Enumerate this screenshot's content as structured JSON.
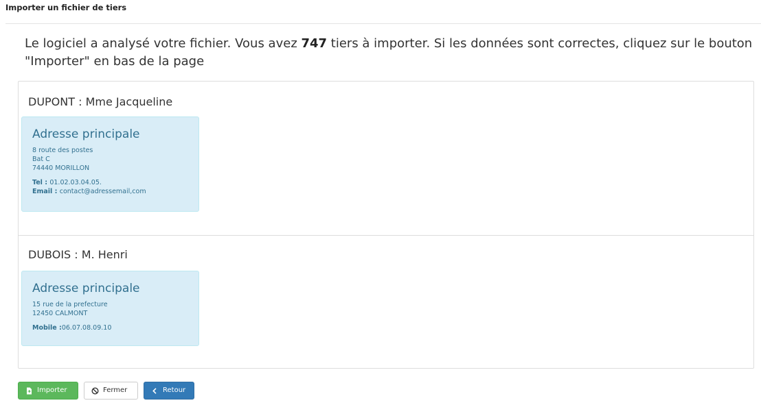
{
  "header": {
    "title": "Importer un fichier de tiers"
  },
  "intro": {
    "text_before": "Le logiciel a analysé votre fichier. Vous avez ",
    "count": "747",
    "text_after": " tiers à importer. Si les données sont correctes, cliquez sur le bouton \"Importer\" en bas de la page"
  },
  "tiers": [
    {
      "name": "DUPONT : Mme Jacqueline",
      "address": {
        "title": "Adresse principale",
        "lines": [
          "8 route des postes",
          "Bat C",
          "74440 MORILLON"
        ],
        "contacts": [
          {
            "label": "Tel : ",
            "value": "01.02.03.04.05."
          },
          {
            "label": "Email : ",
            "value": "contact@adressemail,com"
          }
        ]
      }
    },
    {
      "name": "DUBOIS : M. Henri",
      "address": {
        "title": "Adresse principale",
        "lines": [
          "15 rue de la prefecture",
          "12450 CALMONT"
        ],
        "contacts": [
          {
            "label": "Mobile :",
            "value": "06.07.08.09.10"
          }
        ]
      }
    }
  ],
  "buttons": {
    "import": {
      "label": "Importer",
      "icon": "file-import-icon"
    },
    "close": {
      "label": "Fermer",
      "icon": "ban-icon"
    },
    "back": {
      "label": "Retour",
      "icon": "chevron-left-icon"
    }
  },
  "colors": {
    "success": "#5cb85c",
    "primary": "#337ab7",
    "info_bg": "#d9edf7",
    "info_text": "#31708f"
  }
}
